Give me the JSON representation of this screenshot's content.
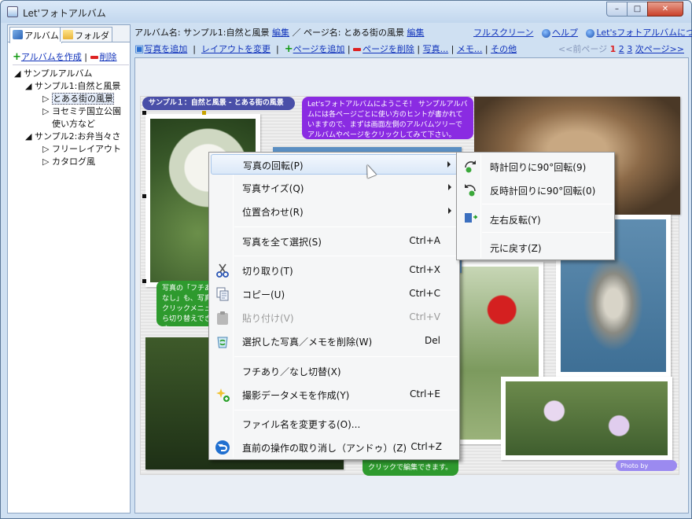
{
  "window": {
    "title": "Let'フォトアルバム",
    "min": "–",
    "max": "□",
    "close": "✕"
  },
  "left": {
    "tabs": [
      {
        "label": "アルバム"
      },
      {
        "label": "フォルダ"
      }
    ],
    "create_album": "アルバムを作成",
    "separator": "|",
    "delete": "削除",
    "tree": [
      {
        "label": "サンプルアルバム",
        "prefix": "◢"
      },
      {
        "label": "サンプル1:自然と風景",
        "prefix": "◢"
      },
      {
        "label": "とある街の風景",
        "prefix": "▷",
        "selected": true
      },
      {
        "label": "ヨセミテ国立公園",
        "prefix": "▷"
      },
      {
        "label": "使い方など",
        "prefix": ""
      },
      {
        "label": "サンプル2:お弁当々さ",
        "prefix": "◢"
      },
      {
        "label": "フリーレイアウト",
        "prefix": "▷"
      },
      {
        "label": "カタログ風",
        "prefix": "▷"
      }
    ]
  },
  "info": {
    "album_label": "アルバム名: サンプル1:自然と風景",
    "edit1": "編集",
    "slash": "／",
    "page_label": "ページ名: とある街の風景",
    "edit2": "編集",
    "fullscreen": "フルスクリーン",
    "help": "ヘルプ",
    "about": "Let'sフォトアルバムについて..."
  },
  "toolbar": {
    "add_photo": "写真を追加",
    "change_layout": "レイアウトを変更",
    "add_page": "ページを追加",
    "delete_page": "ページを削除",
    "photo": "写真...",
    "memo": "メモ...",
    "other": "その他",
    "sep": "|",
    "prev": "<<前ページ",
    "pages": [
      "1",
      "2",
      "3"
    ],
    "next": "次ページ>>"
  },
  "page": {
    "header_tag": "サンプル１：自然と風景 - とある街の風景",
    "welcome": "Let'sフォトアルバムにようこそ！\nサンプルアルバムには各ページごとに使い方のヒントが書かれていますので、まずは画面左側のアルバムツリーでアルバムやページをクリックしてみて下さい。",
    "memo1": "写真の「フチあり／なし」も、写真の右クリックメニューから切り替えできます。",
    "memo2": "クリックで編集できます。",
    "credit": "Photo by hamface"
  },
  "context_menu": {
    "items": [
      {
        "label": "写真の回転(P)",
        "shortcut": "",
        "submenu": true,
        "highlight": true
      },
      {
        "label": "写真サイズ(Q)",
        "shortcut": "",
        "submenu": true
      },
      {
        "label": "位置合わせ(R)",
        "shortcut": "",
        "submenu": true
      },
      {
        "label": "写真を全て選択(S)",
        "shortcut": "Ctrl+A"
      },
      {
        "label": "切り取り(T)",
        "shortcut": "Ctrl+X",
        "icon": "scissors-icon"
      },
      {
        "label": "コピー(U)",
        "shortcut": "Ctrl+C",
        "icon": "copy-icon"
      },
      {
        "label": "貼り付け(V)",
        "shortcut": "Ctrl+V",
        "icon": "paste-icon",
        "disabled": true
      },
      {
        "label": "選択した写真／メモを削除(W)",
        "shortcut": "Del",
        "icon": "recycle-delete-icon"
      },
      {
        "label": "フチあり／なし切替(X)",
        "shortcut": ""
      },
      {
        "label": "撮影データメモを作成(Y)",
        "shortcut": "Ctrl+E",
        "icon": "sparkle-memo-icon"
      },
      {
        "label": "ファイル名を変更する(O)...",
        "shortcut": ""
      },
      {
        "label": "直前の操作の取り消し（アンドゥ）(Z)",
        "shortcut": "Ctrl+Z",
        "icon": "undo-icon"
      }
    ]
  },
  "submenu": {
    "items": [
      {
        "label": "時計回りに90°回転(9)",
        "icon": "rotate-cw-icon"
      },
      {
        "label": "反時計回りに90°回転(0)",
        "icon": "rotate-ccw-icon"
      },
      {
        "label": "左右反転(Y)",
        "icon": "flip-icon"
      },
      {
        "label": "元に戻す(Z)",
        "icon": ""
      }
    ]
  },
  "colors": {
    "accent_link": "#1133bb",
    "menu_highlight": "#dbe8f8",
    "tag_bg": "#4a4fa8",
    "welcome_bg": "#8a2be2",
    "memo_bg": "#2e9a2e"
  }
}
